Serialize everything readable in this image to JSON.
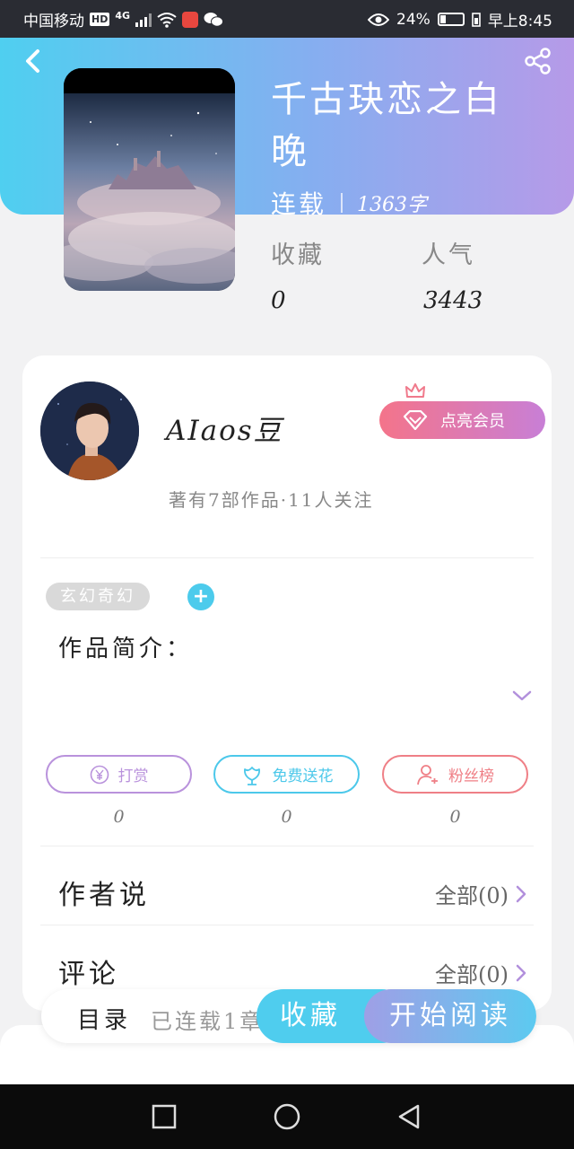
{
  "status_bar": {
    "carrier": "中国移动",
    "hd_badge": "HD",
    "network": "4G",
    "battery": "24%",
    "battery_level": 0.24,
    "time": "早上8:45",
    "icons": [
      "hd-icon",
      "signal-icon",
      "wifi-icon",
      "book-app-icon",
      "wechat-icon",
      "eye-icon",
      "battery-icon",
      "charging-icon"
    ]
  },
  "header": {
    "back_icon": "back-icon",
    "share_icon": "share-icon",
    "gradient": [
      "#4fcff0",
      "#b69ae8"
    ]
  },
  "book": {
    "title": "千古玦恋之白晚",
    "status": "连载",
    "word_count": "1363字",
    "stats": [
      {
        "label": "收藏",
        "value": "0"
      },
      {
        "label": "人气",
        "value": "3443"
      }
    ]
  },
  "author": {
    "name": "AIaos豆",
    "works_info": "著有7部作品·11人关注",
    "vip_button": "点亮会员"
  },
  "genre_tag": "玄幻奇幻",
  "intro_label": "作品简介：",
  "actions": [
    {
      "label": "打赏",
      "count": "0",
      "icon": "yen-icon",
      "color": "#b992dc"
    },
    {
      "label": "免费送花",
      "count": "0",
      "icon": "flower-icon",
      "color": "#4cc8ea"
    },
    {
      "label": "粉丝榜",
      "count": "0",
      "icon": "user-icon",
      "color": "#ef7f86"
    }
  ],
  "author_says": {
    "title": "作者说",
    "link": "全部(0)"
  },
  "comments": {
    "title": "评论",
    "link": "全部(0)"
  },
  "bottom_bar": {
    "toc_label": "目录",
    "toc_sub": "已连载1章",
    "favorite_button": "收藏",
    "read_button": "开始阅读"
  },
  "nav_icons": [
    "recent-apps-icon",
    "home-icon",
    "back-nav-icon"
  ]
}
